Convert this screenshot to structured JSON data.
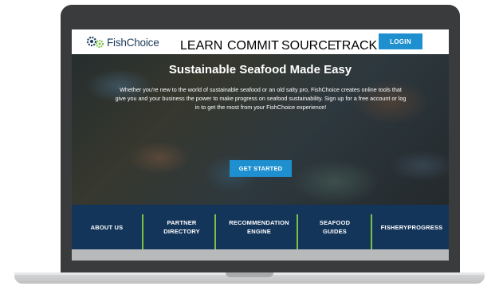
{
  "brand": {
    "name": "FishChoice",
    "colors": {
      "navy": "#1c3a5a",
      "accent": "#1e8fcf",
      "green": "#7cc242",
      "footer": "#13355a"
    }
  },
  "nav": {
    "items": [
      "LEARN",
      "COMMIT",
      "SOURCE",
      "TRACK"
    ],
    "login_label": "LOGIN"
  },
  "hero": {
    "title": "Sustainable Seafood Made Easy",
    "body": "Whether you're new to the world of sustainable seafood or an old salty pro, FishChoice creates online tools that give you and your business the power to make progress on seafood sustainability. Sign up for a free account or log in to get the most from your FishChoice experience!",
    "cta_label": "GET STARTED"
  },
  "footer_nav": {
    "items": [
      "ABOUT US",
      "PARTNER DIRECTORY",
      "RECOMMENDATION ENGINE",
      "SEAFOOD GUIDES",
      "FISHERYPROGRESS"
    ]
  }
}
